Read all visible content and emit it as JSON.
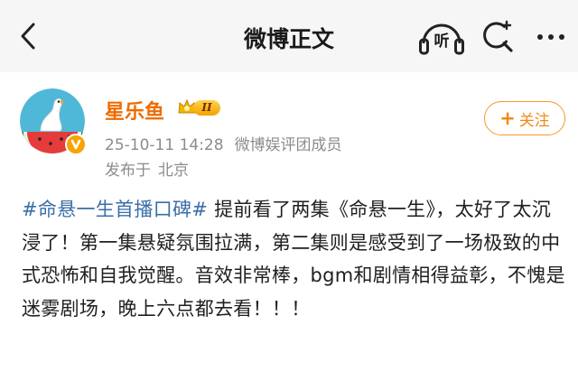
{
  "header": {
    "title": "微博正文",
    "listen_label": "听"
  },
  "post": {
    "author": {
      "name": "星乐鱼",
      "level_badge": "II"
    },
    "meta": {
      "time": "25-10-11 14:28",
      "source": "微博娱评团成员"
    },
    "location": {
      "prefix": "发布于",
      "place": "北京"
    },
    "follow_label": "关注",
    "hashtag": "#命悬一生首播口碑#",
    "body": " 提前看了两集《命悬一生》，太好了太沉浸了！第一集悬疑氛围拉满，第二集则是感受到了一场极致的中式恐怖和自我觉醒。音效非常棒，bgm和剧情相得益彰，不愧是迷雾剧场，晚上六点都去看！！！"
  },
  "colors": {
    "accent": "#f08a17",
    "hashtag": "#3a6ea8",
    "username": "#ef6c00",
    "meta": "#8c8c8c"
  },
  "icons": [
    "back-arrow-icon",
    "headphones-icon",
    "search-icon",
    "more-icon",
    "crown-icon",
    "verified-icon"
  ]
}
